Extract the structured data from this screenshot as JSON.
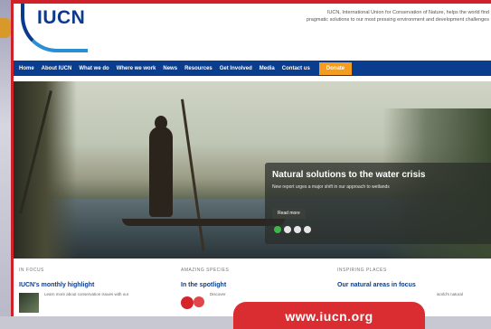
{
  "header": {
    "logo": "IUCN",
    "tagline_line1": "IUCN, International Union for Conservation of Nature, helps the world find",
    "tagline_line2": "pragmatic solutions to our most pressing environment and development challenges"
  },
  "nav": {
    "items": [
      "Home",
      "About IUCN",
      "What we do",
      "Where we work",
      "News",
      "Resources",
      "Get Involved",
      "Media",
      "Contact us"
    ],
    "donate": "Donate"
  },
  "hero": {
    "title": "Natural solutions to the water crisis",
    "subtitle": "New report urges a major shift in our approach to wetlands",
    "button": "Read more"
  },
  "sections": [
    {
      "head": "IN FOCUS",
      "title": "IUCN's monthly highlight",
      "text": "Learn more about conservation issues with our"
    },
    {
      "head": "AMAZING SPECIES",
      "title": "In the spotlight",
      "text": "Discover"
    },
    {
      "head": "INSPIRING PLACES",
      "title": "Our natural areas in focus",
      "text": "world's natural"
    }
  ],
  "watermark": "www.iucn.org",
  "colors": {
    "brand_blue": "#0b3d8f",
    "accent_orange": "#f39c1f",
    "frame_red": "#d0202a",
    "slider_active": "#3fb54a"
  }
}
